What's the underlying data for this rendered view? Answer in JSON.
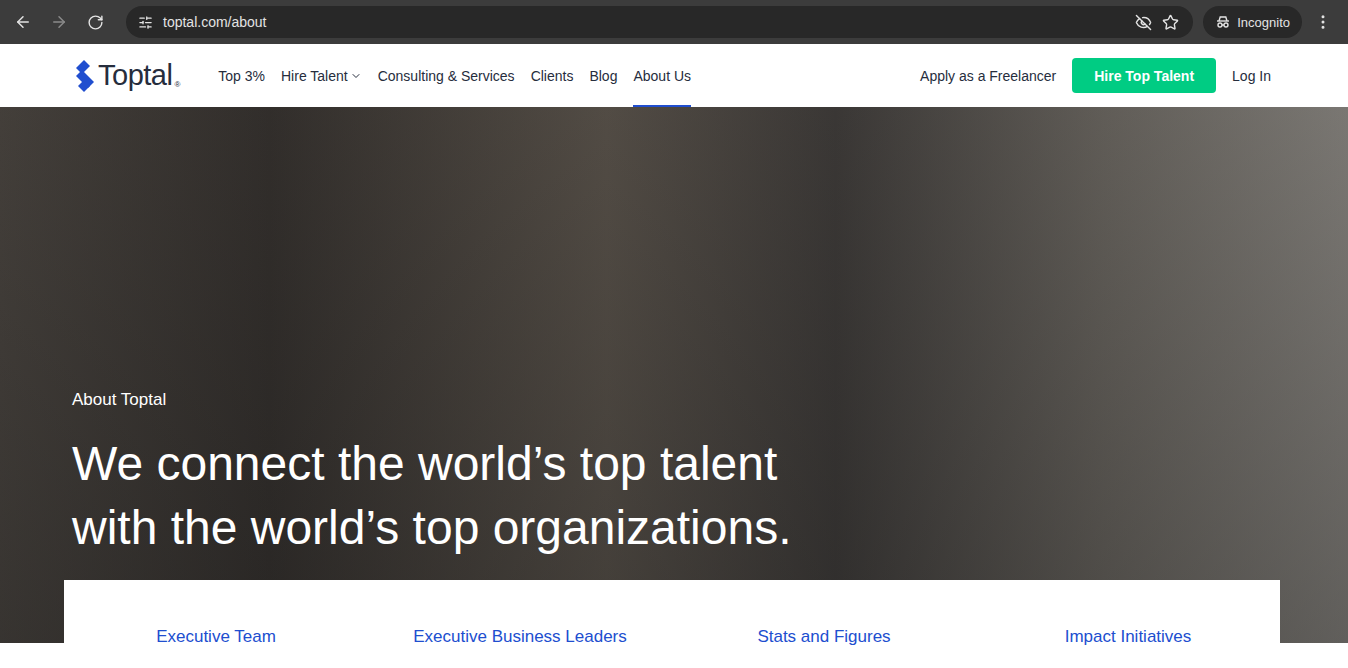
{
  "browser": {
    "url": "toptal.com/about",
    "mode": "Incognito",
    "back_enabled": true,
    "forward_enabled": false,
    "bookmarked": false
  },
  "header": {
    "logo": "Toptal",
    "logo_mark": "®",
    "nav": [
      {
        "label": "Top 3%",
        "selected": false,
        "dropdown": false
      },
      {
        "label": "Hire Talent",
        "selected": false,
        "dropdown": true
      },
      {
        "label": "Consulting & Services",
        "selected": false,
        "dropdown": false
      },
      {
        "label": "Clients",
        "selected": false,
        "dropdown": false
      },
      {
        "label": "Blog",
        "selected": false,
        "dropdown": false
      },
      {
        "label": "About Us",
        "selected": true,
        "dropdown": false
      }
    ],
    "apply": "Apply as a Freelancer",
    "cta": "Hire Top Talent",
    "login": "Log In"
  },
  "hero": {
    "eyebrow": "About Toptal",
    "headline": [
      "We connect the world’s top talent",
      "with the world’s top organizations."
    ]
  },
  "sections": [
    "Executive Team",
    "Executive Business Leaders",
    "Stats and Figures",
    "Impact Initiatives"
  ]
}
